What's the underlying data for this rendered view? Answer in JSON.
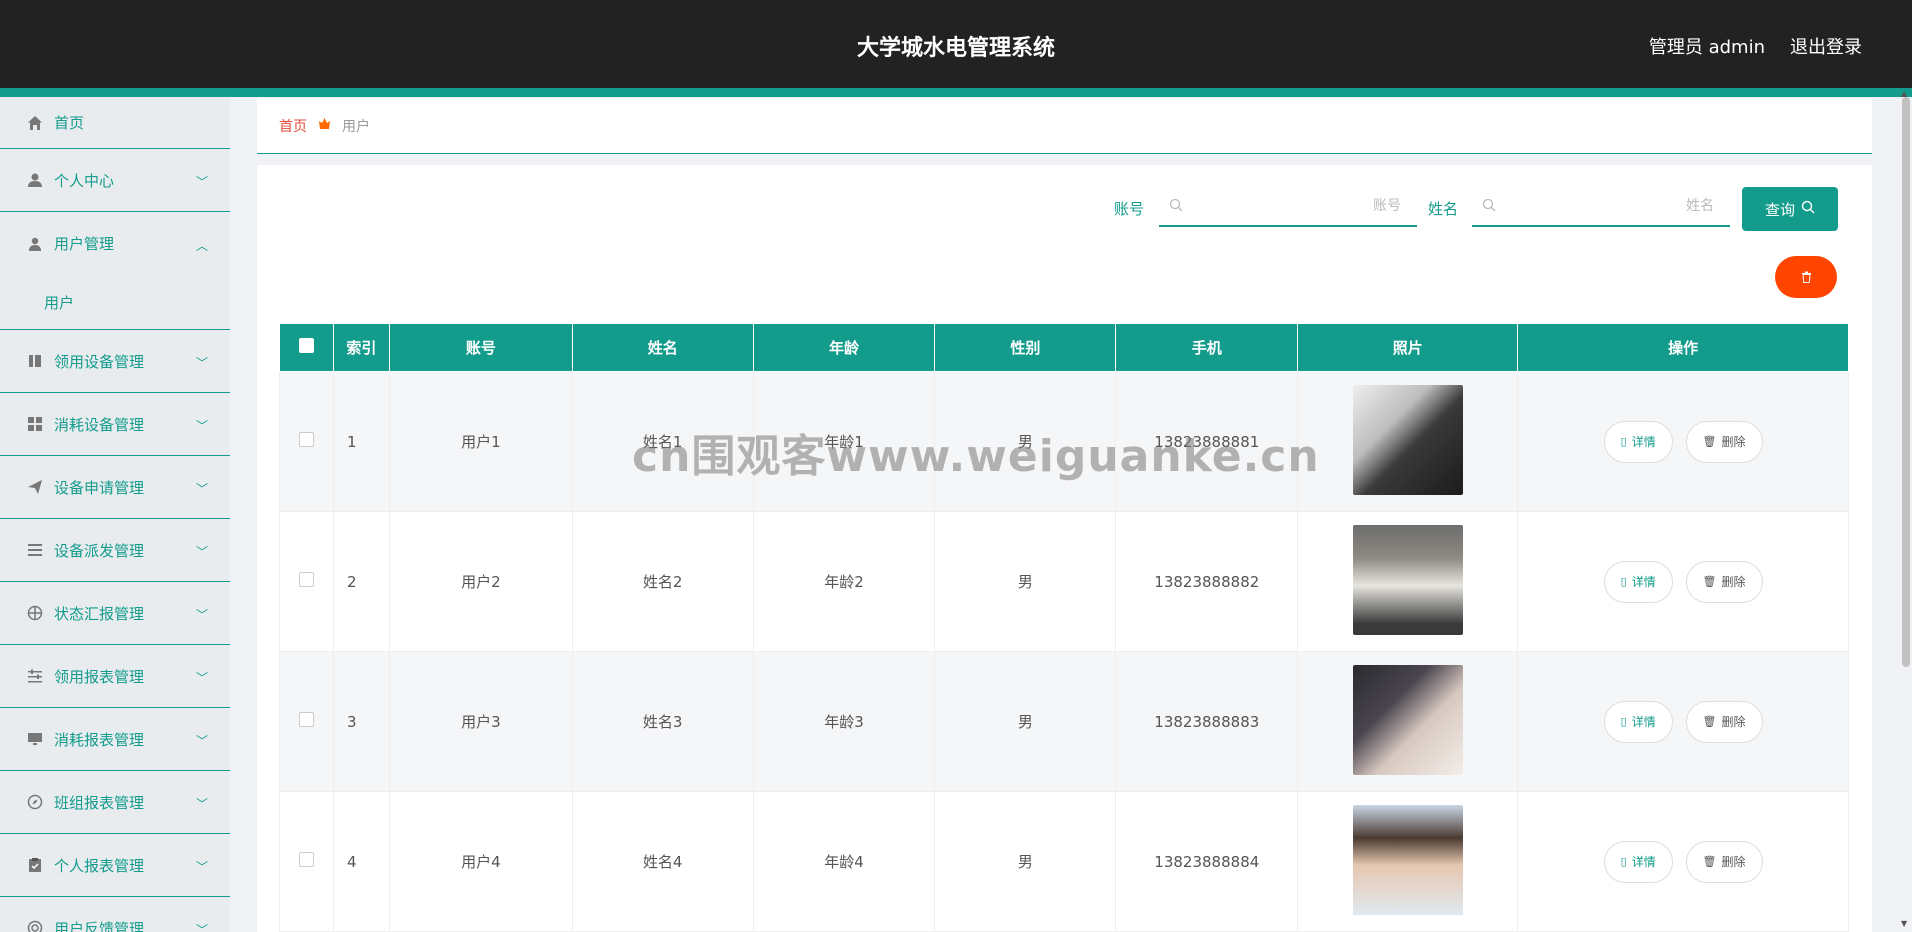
{
  "header": {
    "title": "大学城水电管理系统",
    "admin": "管理员 admin",
    "logout": "退出登录"
  },
  "sidebar": {
    "items": [
      {
        "label": "首页",
        "icon": "home-icon"
      },
      {
        "label": "个人中心",
        "icon": "user-icon"
      },
      {
        "label": "用户管理",
        "icon": "user-manage-icon",
        "expanded": true
      },
      {
        "label": "领用设备管理",
        "icon": "bookmark-icon"
      },
      {
        "label": "消耗设备管理",
        "icon": "grid-icon"
      },
      {
        "label": "设备申请管理",
        "icon": "send-icon"
      },
      {
        "label": "设备派发管理",
        "icon": "list-icon"
      },
      {
        "label": "状态汇报管理",
        "icon": "target-icon"
      },
      {
        "label": "领用报表管理",
        "icon": "sliders-icon"
      },
      {
        "label": "消耗报表管理",
        "icon": "monitor-icon"
      },
      {
        "label": "班组报表管理",
        "icon": "compass-icon"
      },
      {
        "label": "个人报表管理",
        "icon": "clipboard-icon"
      },
      {
        "label": "用户反馈管理",
        "icon": "help-icon"
      }
    ],
    "submenu": {
      "label": "用户"
    }
  },
  "breadcrumb": {
    "home": "首页",
    "current": "用户"
  },
  "search": {
    "account_label": "账号",
    "account_placeholder": "账号",
    "name_label": "姓名",
    "name_placeholder": "姓名",
    "query_button": "查询"
  },
  "table": {
    "headers": [
      "索引",
      "账号",
      "姓名",
      "年龄",
      "性别",
      "手机",
      "照片",
      "操作"
    ],
    "rows": [
      {
        "index": "1",
        "account": "用户1",
        "name": "姓名1",
        "age": "年龄1",
        "gender": "男",
        "phone": "13823888881"
      },
      {
        "index": "2",
        "account": "用户2",
        "name": "姓名2",
        "age": "年龄2",
        "gender": "男",
        "phone": "13823888882"
      },
      {
        "index": "3",
        "account": "用户3",
        "name": "姓名3",
        "age": "年龄3",
        "gender": "男",
        "phone": "13823888883"
      },
      {
        "index": "4",
        "account": "用户4",
        "name": "姓名4",
        "age": "年龄4",
        "gender": "男",
        "phone": "13823888884"
      }
    ],
    "actions": {
      "detail": "详情",
      "delete": "删除"
    }
  },
  "watermark": "cn围观客www.weiguanke.cn",
  "colors": {
    "accent": "#139c8c",
    "header_bg": "#222222",
    "danger": "#ff4500"
  }
}
